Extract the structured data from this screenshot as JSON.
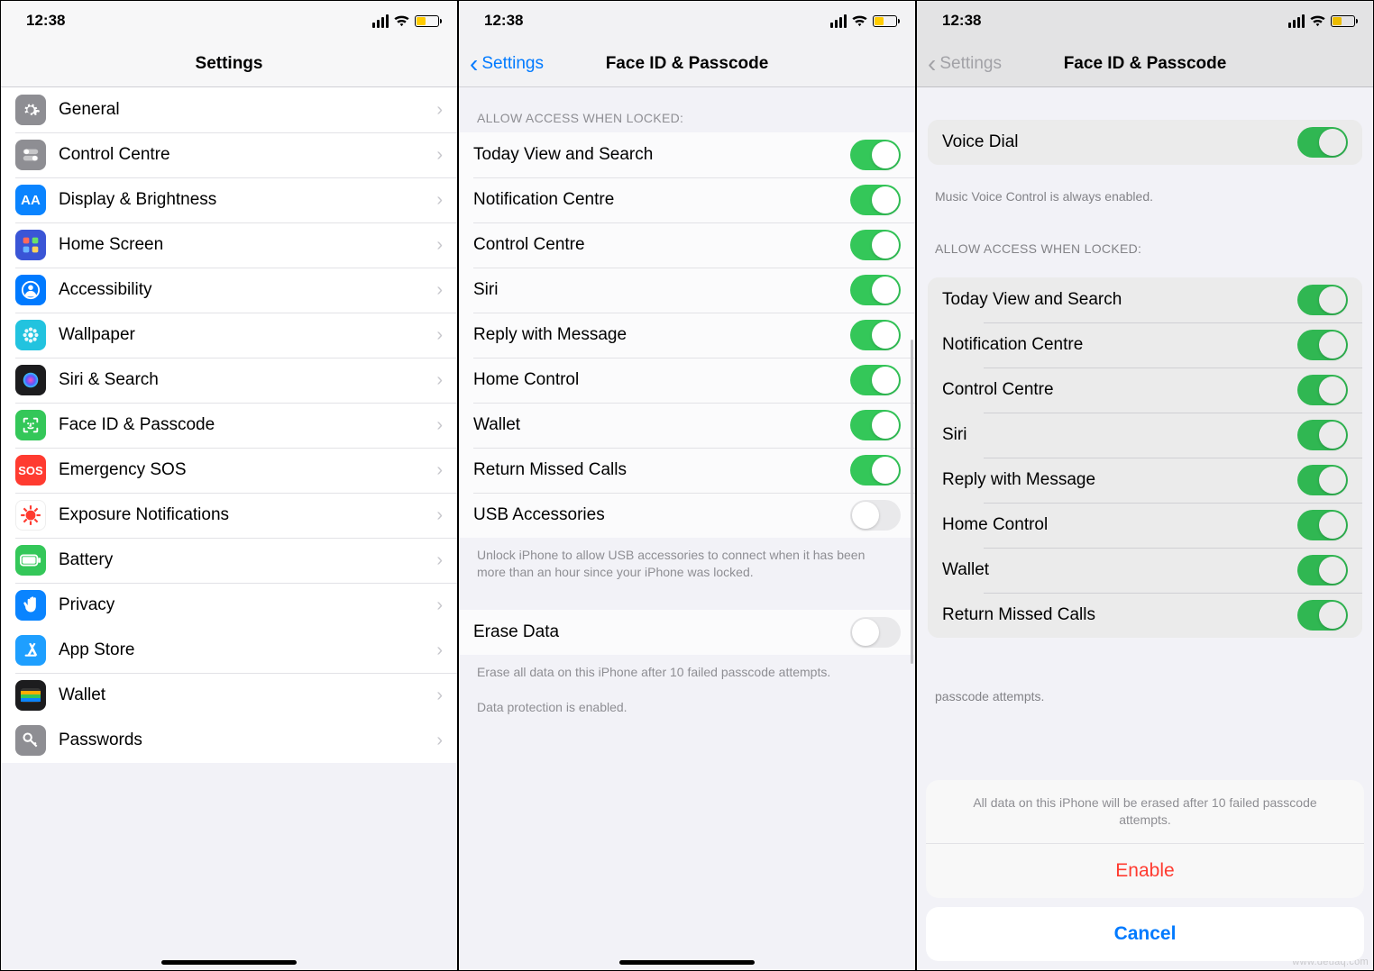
{
  "status": {
    "time": "12:38"
  },
  "p1": {
    "title": "Settings",
    "groups": [
      [
        {
          "icon": "gear",
          "bg": "#8e8e93",
          "label": "General"
        },
        {
          "icon": "toggles",
          "bg": "#8e8e93",
          "label": "Control Centre"
        },
        {
          "icon": "AA",
          "bg": "#0a84ff",
          "label": "Display & Brightness"
        },
        {
          "icon": "grid",
          "bg": "#3a55d6",
          "label": "Home Screen"
        },
        {
          "icon": "person",
          "bg": "#007aff",
          "label": "Accessibility"
        },
        {
          "icon": "flower",
          "bg": "#22c3df",
          "label": "Wallpaper"
        },
        {
          "icon": "siri",
          "bg": "#1c1c1e",
          "label": "Siri & Search"
        },
        {
          "icon": "faceid",
          "bg": "#34c759",
          "label": "Face ID & Passcode"
        },
        {
          "icon": "sos",
          "bg": "#ff3b30",
          "label": "Emergency SOS"
        },
        {
          "icon": "virus",
          "bg": "#ffffff",
          "label": "Exposure Notifications"
        },
        {
          "icon": "battery",
          "bg": "#34c759",
          "label": "Battery"
        },
        {
          "icon": "hand",
          "bg": "#0a84ff",
          "label": "Privacy"
        }
      ],
      [
        {
          "icon": "appstore",
          "bg": "#1e9fff",
          "label": "App Store"
        },
        {
          "icon": "wallet",
          "bg": "#1c1c1e",
          "label": "Wallet"
        }
      ],
      [
        {
          "icon": "key",
          "bg": "#8e8e93",
          "label": "Passwords"
        }
      ]
    ]
  },
  "p2": {
    "back": "Settings",
    "title": "Face ID & Passcode",
    "allow_header": "ALLOW ACCESS WHEN LOCKED:",
    "access_items": [
      {
        "label": "Today View and Search",
        "on": true
      },
      {
        "label": "Notification Centre",
        "on": true
      },
      {
        "label": "Control Centre",
        "on": true
      },
      {
        "label": "Siri",
        "on": true
      },
      {
        "label": "Reply with Message",
        "on": true
      },
      {
        "label": "Home Control",
        "on": true
      },
      {
        "label": "Wallet",
        "on": true
      },
      {
        "label": "Return Missed Calls",
        "on": true
      },
      {
        "label": "USB Accessories",
        "on": false
      }
    ],
    "usb_footer": "Unlock iPhone to allow USB accessories to connect when it has been more than an hour since your iPhone was locked.",
    "erase": {
      "label": "Erase Data",
      "on": false
    },
    "erase_footer": "Erase all data on this iPhone after 10 failed passcode attempts.",
    "dp_footer": "Data protection is enabled."
  },
  "p3": {
    "back": "Settings",
    "title": "Face ID & Passcode",
    "voice_dial": {
      "label": "Voice Dial",
      "on": true
    },
    "voice_footer": "Music Voice Control is always enabled.",
    "allow_header": "ALLOW ACCESS WHEN LOCKED:",
    "access_items": [
      {
        "label": "Today View and Search",
        "on": true
      },
      {
        "label": "Notification Centre",
        "on": true
      },
      {
        "label": "Control Centre",
        "on": true
      },
      {
        "label": "Siri",
        "on": true
      },
      {
        "label": "Reply with Message",
        "on": true
      },
      {
        "label": "Home Control",
        "on": true
      },
      {
        "label": "Wallet",
        "on": true
      },
      {
        "label": "Return Missed Calls",
        "on": true
      }
    ],
    "passcode_footer": "passcode attempts.",
    "sheet": {
      "message": "All data on this iPhone will be erased after 10 failed passcode attempts.",
      "enable": "Enable",
      "cancel": "Cancel"
    }
  },
  "watermark": "www.deuaq.com"
}
